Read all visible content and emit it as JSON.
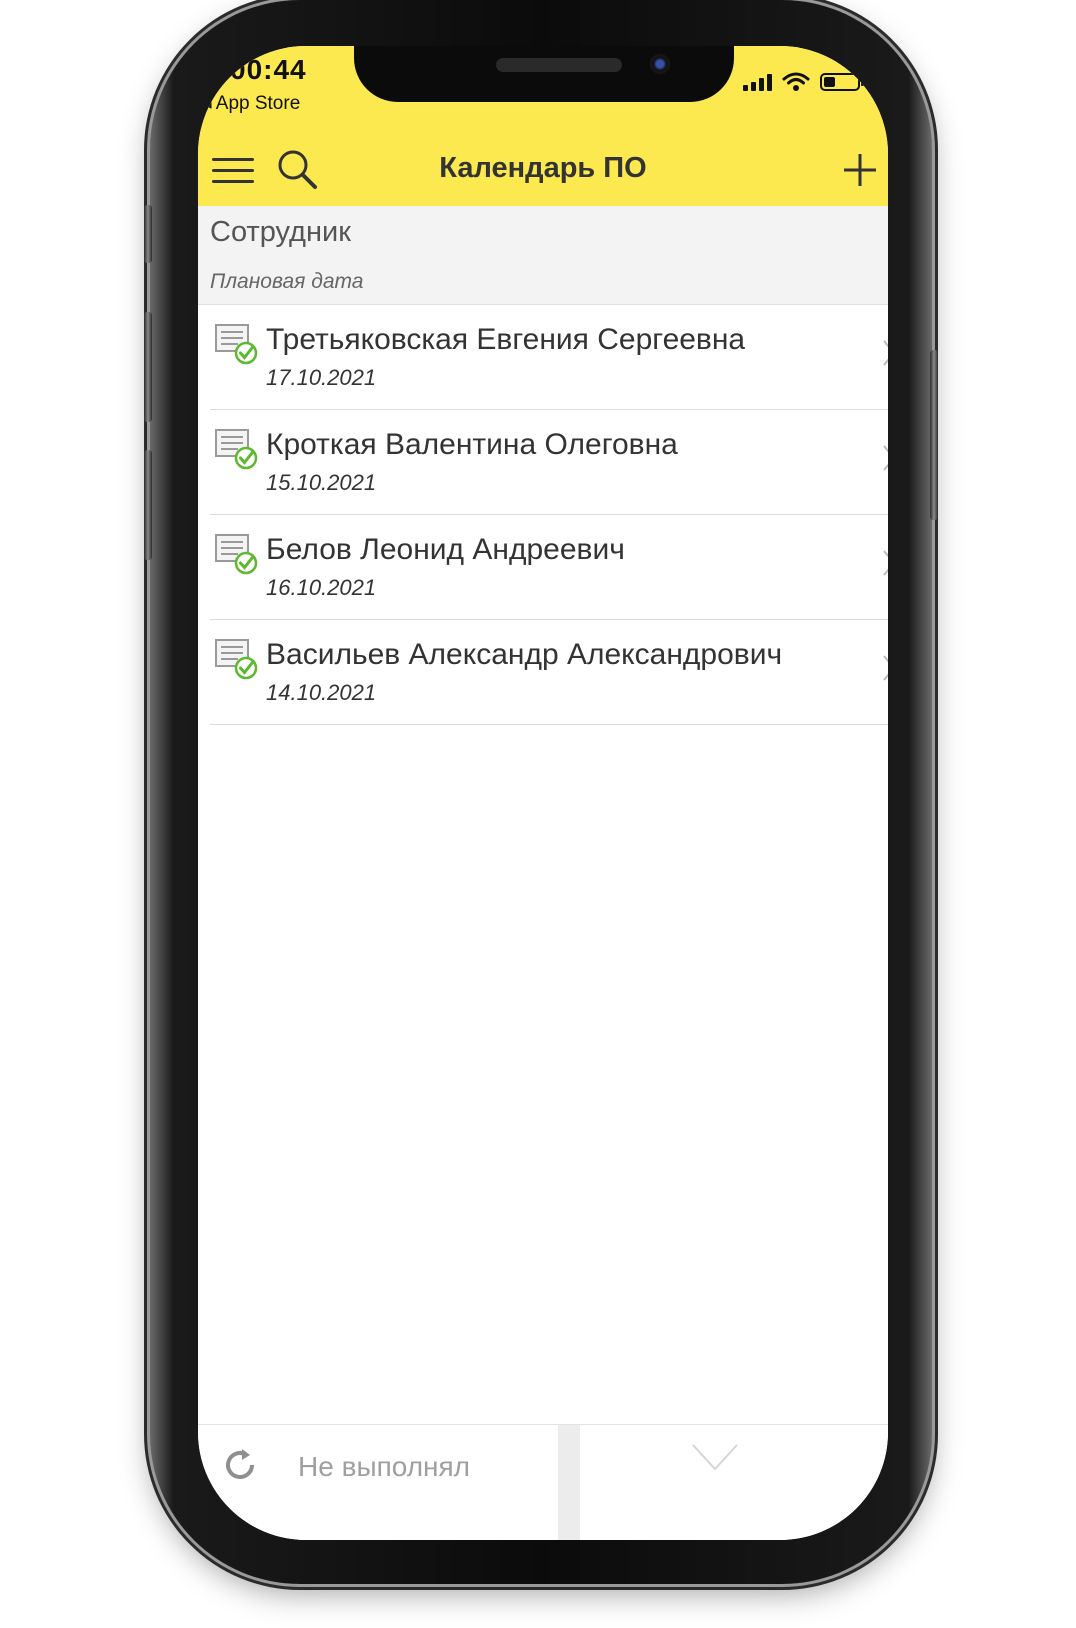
{
  "status_bar": {
    "time": "00:44",
    "back_app": "◂ App Store",
    "signal_bars": 4,
    "battery_level": 0.35
  },
  "header": {
    "title": "Календарь ПО",
    "icons": [
      "menu-icon",
      "search-icon",
      "plus-icon"
    ],
    "background_color": "#fce94f"
  },
  "list_header": {
    "primary_column": "Сотрудник",
    "secondary_column": "Плановая дата"
  },
  "items": [
    {
      "name": "Третьяковская Евгения Сергеевна",
      "date": "17.10.2021",
      "icon": "document-checked-icon"
    },
    {
      "name": "Кроткая Валентина Олеговна",
      "date": "15.10.2021",
      "icon": "document-checked-icon"
    },
    {
      "name": "Белов Леонид Андреевич",
      "date": "16.10.2021",
      "icon": "document-checked-icon"
    },
    {
      "name": "Васильев Александр Александрович",
      "date": "14.10.2021",
      "icon": "document-checked-icon"
    }
  ],
  "bottom_bar": {
    "label": "Не выполнял",
    "icons": [
      "refresh-icon",
      "check-icon"
    ]
  },
  "colors": {
    "accent_yellow": "#fce94f",
    "check_green": "#5cb82e"
  }
}
